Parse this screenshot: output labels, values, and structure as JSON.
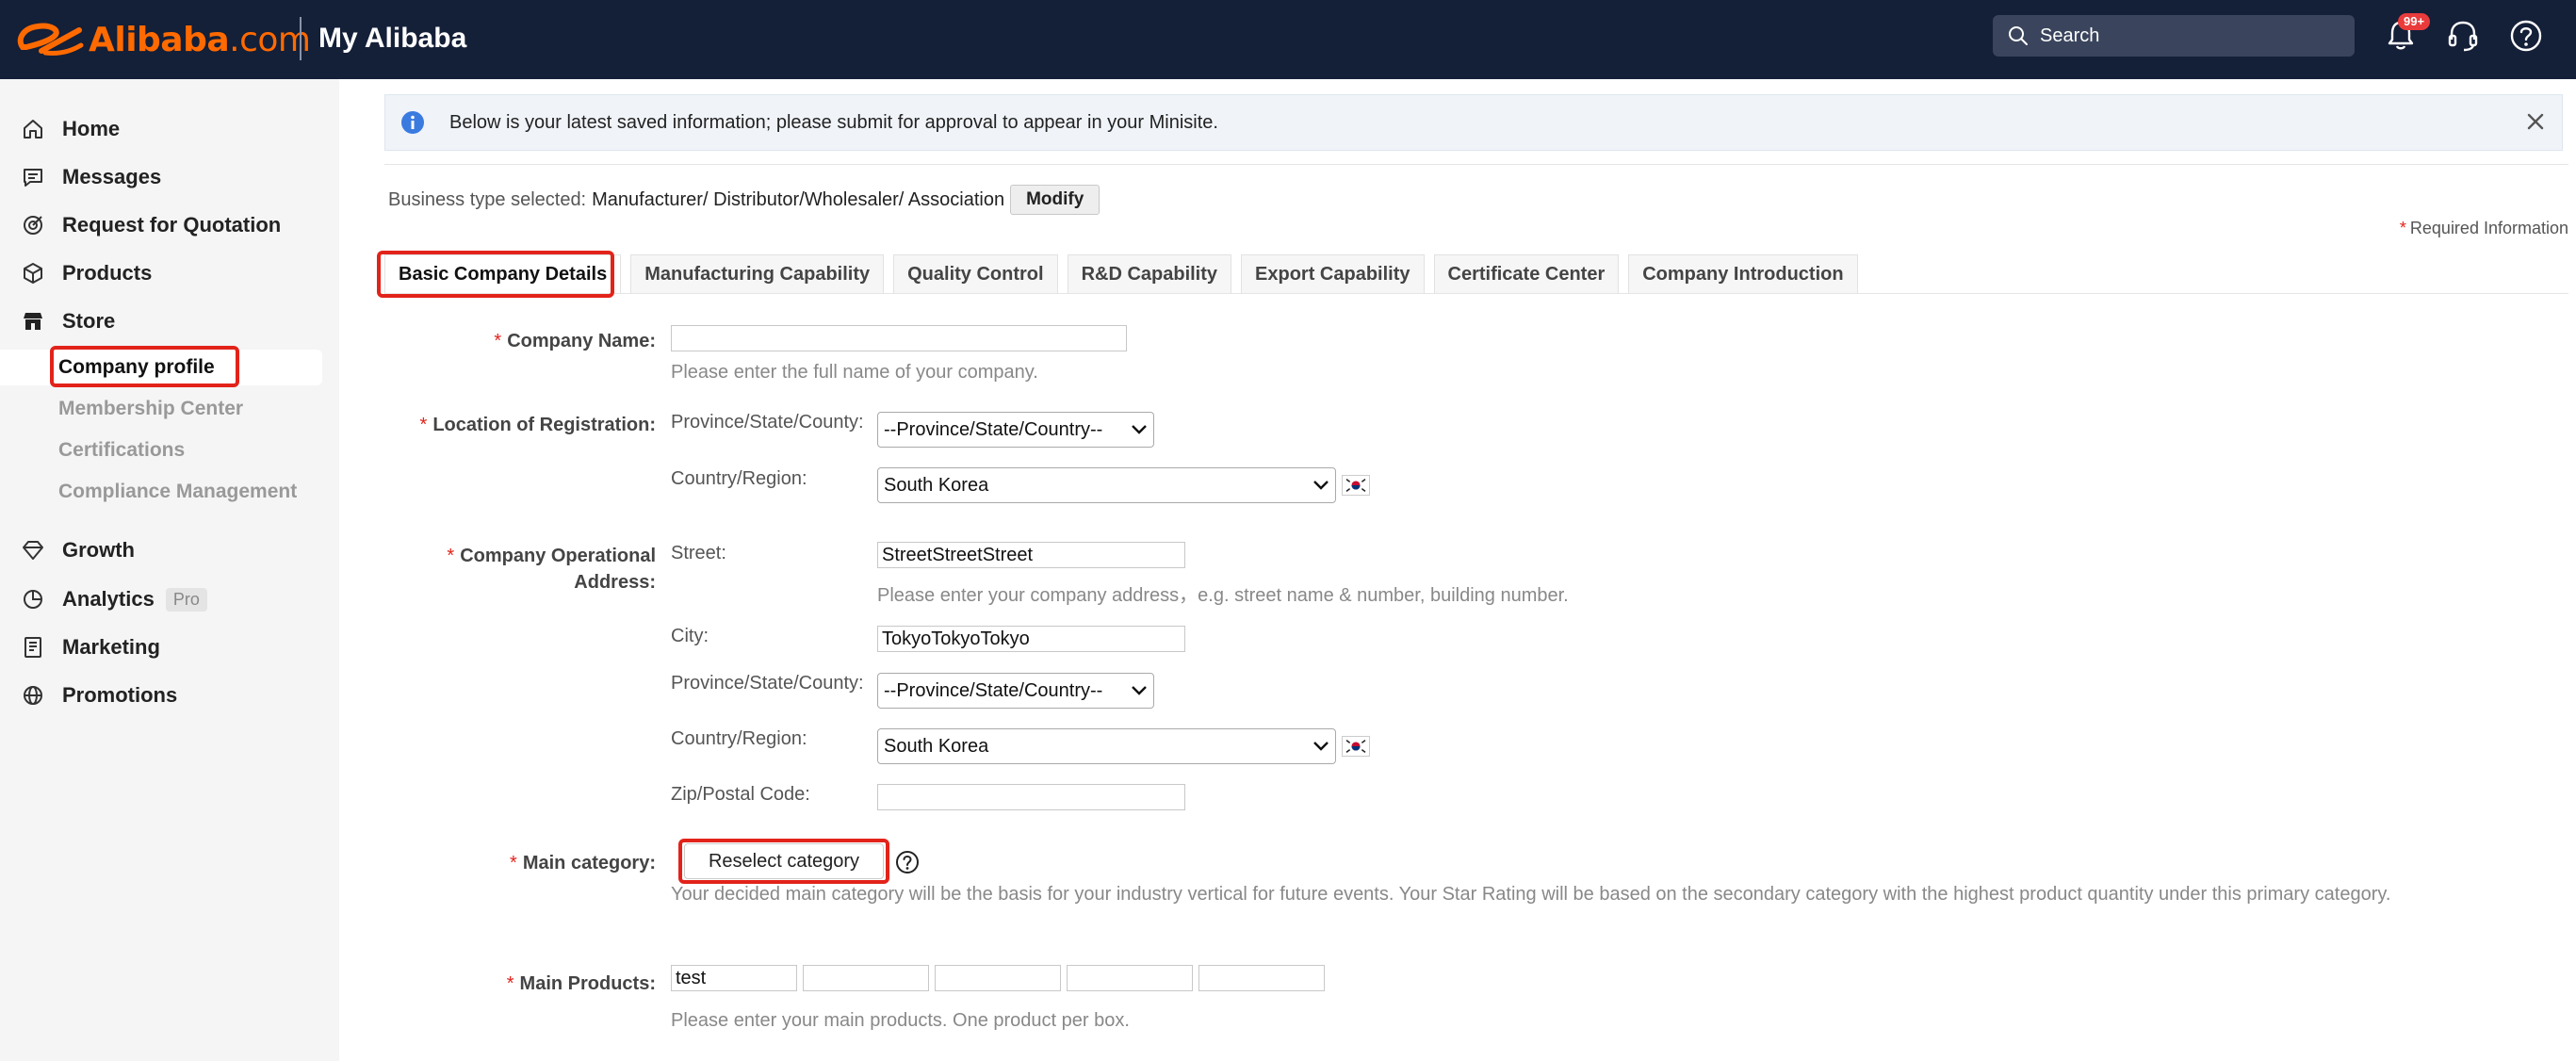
{
  "header": {
    "logo_text": "Alibaba",
    "logo_suffix": ".com",
    "app_title": "My Alibaba",
    "search_placeholder": "Search",
    "notification_badge": "99+"
  },
  "sidebar": {
    "items": [
      {
        "label": "Home",
        "icon": "home-icon"
      },
      {
        "label": "Messages",
        "icon": "messages-icon"
      },
      {
        "label": "Request for Quotation",
        "icon": "target-icon"
      },
      {
        "label": "Products",
        "icon": "box-icon"
      },
      {
        "label": "Store",
        "icon": "store-icon"
      },
      {
        "label": "Growth",
        "icon": "diamond-icon"
      },
      {
        "label": "Analytics",
        "icon": "pie-chart-icon",
        "badge": "Pro"
      },
      {
        "label": "Marketing",
        "icon": "document-icon"
      },
      {
        "label": "Promotions",
        "icon": "globe-icon"
      }
    ],
    "store_subitems": [
      "Company profile",
      "Membership Center",
      "Certifications",
      "Compliance Management"
    ],
    "active_subitem": "Company profile"
  },
  "notice": {
    "text": "Below is your latest saved information; please submit for approval to appear in your Minisite."
  },
  "business": {
    "label": "Business type selected:",
    "value": "Manufacturer/ Distributor/Wholesaler/ Association",
    "modify_label": "Modify"
  },
  "required_info": "Required Information",
  "tabs": [
    "Basic Company Details",
    "Manufacturing Capability",
    "Quality Control",
    "R&D Capability",
    "Export Capability",
    "Certificate Center",
    "Company Introduction"
  ],
  "active_tab": "Basic Company Details",
  "form": {
    "company_name": {
      "label": "Company Name:",
      "value": "",
      "hint": "Please enter the full name of your company."
    },
    "registration": {
      "label": "Location of Registration:",
      "province_label": "Province/State/County:",
      "province_value": "--Province/State/Country--",
      "country_label": "Country/Region:",
      "country_value": "South Korea"
    },
    "operational_address": {
      "label_line1": "Company Operational",
      "label_line2": "Address:",
      "street_label": "Street:",
      "street_value": "StreetStreetStreet",
      "street_hint": "Please enter your company address，e.g. street name & number, building number.",
      "city_label": "City:",
      "city_value": "TokyoTokyoTokyo",
      "province_label": "Province/State/County:",
      "province_value": "--Province/State/Country--",
      "country_label": "Country/Region:",
      "country_value": "South Korea",
      "zip_label": "Zip/Postal Code:",
      "zip_value": ""
    },
    "main_category": {
      "label": "Main category:",
      "button_label": "Reselect category",
      "hint": "Your decided main category will be the basis for your industry vertical for future events. Your Star Rating will be based on the secondary category with the highest product quantity under this primary category."
    },
    "main_products": {
      "label": "Main Products:",
      "values": [
        "test",
        "",
        "",
        "",
        ""
      ],
      "hint": "Please enter your main products. One product per box."
    }
  },
  "colors": {
    "topbar": "#141f38",
    "brand": "#ff6a00",
    "highlight": "#e2231a",
    "sidebar_bg": "#f5f5f5"
  }
}
